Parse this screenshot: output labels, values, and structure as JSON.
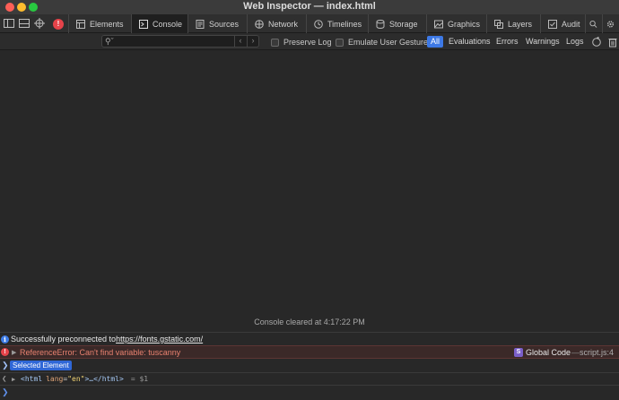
{
  "window": {
    "title": "Web Inspector — index.html"
  },
  "tabs": [
    {
      "label": "Elements",
      "icon": "elements-icon"
    },
    {
      "label": "Console",
      "icon": "console-icon"
    },
    {
      "label": "Sources",
      "icon": "sources-icon"
    },
    {
      "label": "Network",
      "icon": "network-icon"
    },
    {
      "label": "Timelines",
      "icon": "timelines-icon"
    },
    {
      "label": "Storage",
      "icon": "storage-icon"
    },
    {
      "label": "Graphics",
      "icon": "graphics-icon"
    },
    {
      "label": "Layers",
      "icon": "layers-icon"
    },
    {
      "label": "Audit",
      "icon": "audit-icon"
    }
  ],
  "active_tab": "Console",
  "error_count": "!",
  "filter": {
    "search_value": "",
    "preserve_log": "Preserve Log",
    "emulate_gesture": "Emulate User Gesture",
    "levels": [
      "All",
      "Evaluations",
      "Errors",
      "Warnings",
      "Logs"
    ],
    "active_level": "All"
  },
  "console": {
    "cleared_text": "Console cleared at 4:17:22 PM",
    "info_prefix": "Successfully preconnected to ",
    "info_link": "https://fonts.gstatic.com/",
    "error_text": "ReferenceError: Can't find variable: tuscanny",
    "error_source_badge": "S",
    "error_source": "Global Code",
    "error_dash": "—",
    "error_location": "script.js:4",
    "selected_label": "Selected Element",
    "html_tag_open": "<html",
    "html_attr_name": "lang",
    "html_attr_value": "\"en\"",
    "html_ellipsis": ">…</html>",
    "html_var": "= $1"
  },
  "colors": {
    "accent": "#3d79e6",
    "error": "#e6434a",
    "error_text": "#e8816f"
  }
}
